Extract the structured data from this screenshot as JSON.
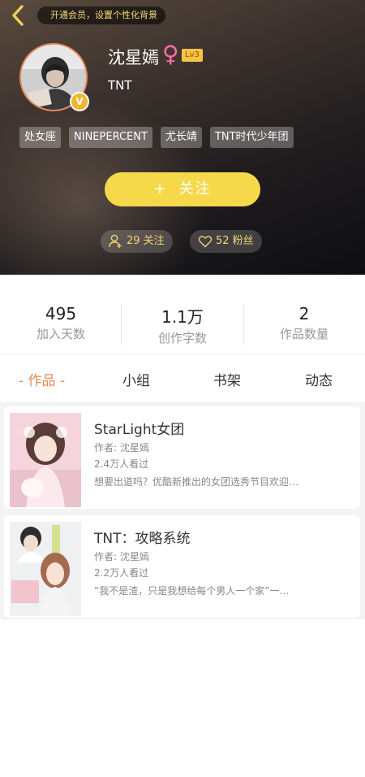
{
  "header": {
    "vip_banner": "开通会员，设置个性化背景",
    "name": "沈星嫣",
    "gender_symbol": "♀",
    "level": "Lv3",
    "group": "TNT",
    "tags": [
      "处女座",
      "NINEPERCENT",
      "尤长靖",
      "TNT时代少年团"
    ],
    "follow_button": "关注",
    "following": "29 关注",
    "followers": "52 粉丝",
    "colors": {
      "accent_yellow": "#f6d94b",
      "gold_text": "#f3d571",
      "avatar_border": "#e88b5a"
    }
  },
  "stats": [
    {
      "value": "495",
      "label": "加入天数"
    },
    {
      "value": "1.1万",
      "label": "创作字数"
    },
    {
      "value": "2",
      "label": "作品数量"
    }
  ],
  "tabs": [
    {
      "label": "- 作品 -",
      "active": true
    },
    {
      "label": "小组"
    },
    {
      "label": "书架"
    },
    {
      "label": "动态"
    }
  ],
  "works": [
    {
      "title": "StarLight女团",
      "author": "作者: 沈星嫣",
      "views": "2.4万人看过",
      "desc": "想要出道吗？优酷新推出的女团选秀节目欢迎…"
    },
    {
      "title": "TNT：攻略系统",
      "author": "作者: 沈星嫣",
      "views": "2.2万人看过",
      "desc": "“我不是渣，只是我想给每个男人一个家”一…"
    }
  ]
}
